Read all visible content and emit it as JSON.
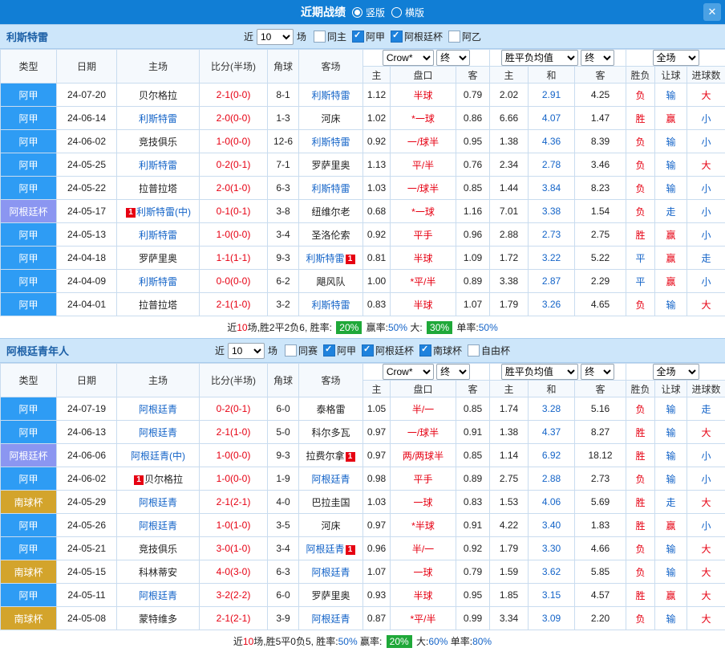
{
  "top_bar": {
    "title": "近期战绩",
    "vertical_label": "竖版",
    "horizontal_label": "横版",
    "close_label": "✕"
  },
  "table_header": {
    "type": "类型",
    "date": "日期",
    "home": "主场",
    "score": "比分(半场)",
    "corner": "角球",
    "away": "客场",
    "company_dd": "Crow*",
    "final_dd": "终",
    "europe_dd": "胜平负均值",
    "scope_dd": "全场",
    "sub": {
      "a_home": "主",
      "handicap": "盘口",
      "a_away": "客",
      "e_home": "主",
      "e_draw": "和",
      "e_away": "客",
      "result": "胜负",
      "let": "让球",
      "goals": "进球数"
    }
  },
  "colors": {
    "league_jia": "#2e9cf4",
    "league_cup": "#8b96f1",
    "league_south": "#d3a42c",
    "accent_red": "#e60012",
    "accent_blue": "#1464c8",
    "badge_green": "#1fa839",
    "topbar_blue": "#117ed5"
  },
  "sections": [
    {
      "team": "利斯特雷",
      "filter": {
        "near_label": "近",
        "count": "10",
        "games_label": "场",
        "checkboxes": [
          {
            "label": "同主",
            "checked": false
          },
          {
            "label": "阿甲",
            "checked": true
          },
          {
            "label": "阿根廷杯",
            "checked": true
          },
          {
            "label": "阿乙",
            "checked": false
          }
        ]
      },
      "rows": [
        {
          "league": "阿甲",
          "league_class": "jia",
          "date": "24-07-20",
          "home": {
            "name": "贝尔格拉"
          },
          "score": "2-1(0-0)",
          "corner": "8-1",
          "away": {
            "name": "利斯特雷",
            "focus": true
          },
          "asian": [
            "1.12",
            "半球",
            "0.79"
          ],
          "euro": [
            "2.02",
            "2.91",
            "4.25"
          ],
          "results": [
            {
              "t": "负",
              "c": "red"
            },
            {
              "t": "输",
              "c": "blue"
            },
            {
              "t": "大",
              "c": "red"
            }
          ]
        },
        {
          "league": "阿甲",
          "league_class": "jia",
          "date": "24-06-14",
          "home": {
            "name": "利斯特雷",
            "focus": true
          },
          "score": "2-0(0-0)",
          "corner": "1-3",
          "away": {
            "name": "河床"
          },
          "asian": [
            "1.02",
            "*一球",
            "0.86"
          ],
          "euro": [
            "6.66",
            "4.07",
            "1.47"
          ],
          "results": [
            {
              "t": "胜",
              "c": "red"
            },
            {
              "t": "赢",
              "c": "red"
            },
            {
              "t": "小",
              "c": "blue"
            }
          ]
        },
        {
          "league": "阿甲",
          "league_class": "jia",
          "date": "24-06-02",
          "home": {
            "name": "竞技俱乐"
          },
          "score": "1-0(0-0)",
          "corner": "12-6",
          "away": {
            "name": "利斯特雷",
            "focus": true
          },
          "asian": [
            "0.92",
            "一/球半",
            "0.95"
          ],
          "euro": [
            "1.38",
            "4.36",
            "8.39"
          ],
          "results": [
            {
              "t": "负",
              "c": "red"
            },
            {
              "t": "输",
              "c": "blue"
            },
            {
              "t": "小",
              "c": "blue"
            }
          ]
        },
        {
          "league": "阿甲",
          "league_class": "jia",
          "date": "24-05-25",
          "home": {
            "name": "利斯特雷",
            "focus": true
          },
          "score": "0-2(0-1)",
          "corner": "7-1",
          "away": {
            "name": "罗萨里奥"
          },
          "asian": [
            "1.13",
            "平/半",
            "0.76"
          ],
          "euro": [
            "2.34",
            "2.78",
            "3.46"
          ],
          "results": [
            {
              "t": "负",
              "c": "red"
            },
            {
              "t": "输",
              "c": "blue"
            },
            {
              "t": "大",
              "c": "red"
            }
          ]
        },
        {
          "league": "阿甲",
          "league_class": "jia",
          "date": "24-05-22",
          "home": {
            "name": "拉普拉塔"
          },
          "score": "2-0(1-0)",
          "corner": "6-3",
          "away": {
            "name": "利斯特雷",
            "focus": true
          },
          "asian": [
            "1.03",
            "一/球半",
            "0.85"
          ],
          "euro": [
            "1.44",
            "3.84",
            "8.23"
          ],
          "results": [
            {
              "t": "负",
              "c": "red"
            },
            {
              "t": "输",
              "c": "blue"
            },
            {
              "t": "小",
              "c": "blue"
            }
          ]
        },
        {
          "league": "阿根廷杯",
          "league_class": "cup",
          "date": "24-05-17",
          "home": {
            "name": "利斯特雷(中)",
            "focus": true,
            "badge_before": "1"
          },
          "score": "0-1(0-1)",
          "corner": "3-8",
          "away": {
            "name": "纽维尔老"
          },
          "asian": [
            "0.68",
            "*一球",
            "1.16"
          ],
          "euro": [
            "7.01",
            "3.38",
            "1.54"
          ],
          "results": [
            {
              "t": "负",
              "c": "red"
            },
            {
              "t": "走",
              "c": "blue"
            },
            {
              "t": "小",
              "c": "blue"
            }
          ]
        },
        {
          "league": "阿甲",
          "league_class": "jia",
          "date": "24-05-13",
          "home": {
            "name": "利斯特雷",
            "focus": true
          },
          "score": "1-0(0-0)",
          "corner": "3-4",
          "away": {
            "name": "圣洛伦索"
          },
          "asian": [
            "0.92",
            "平手",
            "0.96"
          ],
          "euro": [
            "2.88",
            "2.73",
            "2.75"
          ],
          "results": [
            {
              "t": "胜",
              "c": "red"
            },
            {
              "t": "赢",
              "c": "red"
            },
            {
              "t": "小",
              "c": "blue"
            }
          ]
        },
        {
          "league": "阿甲",
          "league_class": "jia",
          "date": "24-04-18",
          "home": {
            "name": "罗萨里奥"
          },
          "score": "1-1(1-1)",
          "corner": "9-3",
          "away": {
            "name": "利斯特雷",
            "focus": true,
            "badge_after": "1"
          },
          "asian": [
            "0.81",
            "半球",
            "1.09"
          ],
          "euro": [
            "1.72",
            "3.22",
            "5.22"
          ],
          "results": [
            {
              "t": "平",
              "c": "blue"
            },
            {
              "t": "赢",
              "c": "red"
            },
            {
              "t": "走",
              "c": "blue"
            }
          ]
        },
        {
          "league": "阿甲",
          "league_class": "jia",
          "date": "24-04-09",
          "home": {
            "name": "利斯特雷",
            "focus": true
          },
          "score": "0-0(0-0)",
          "corner": "6-2",
          "away": {
            "name": "飓风队"
          },
          "asian": [
            "1.00",
            "*平/半",
            "0.89"
          ],
          "euro": [
            "3.38",
            "2.87",
            "2.29"
          ],
          "results": [
            {
              "t": "平",
              "c": "blue"
            },
            {
              "t": "赢",
              "c": "red"
            },
            {
              "t": "小",
              "c": "blue"
            }
          ]
        },
        {
          "league": "阿甲",
          "league_class": "jia",
          "date": "24-04-01",
          "home": {
            "name": "拉普拉塔"
          },
          "score": "2-1(1-0)",
          "corner": "3-2",
          "away": {
            "name": "利斯特雷",
            "focus": true
          },
          "asian": [
            "0.83",
            "半球",
            "1.07"
          ],
          "euro": [
            "1.79",
            "3.26",
            "4.65"
          ],
          "results": [
            {
              "t": "负",
              "c": "red"
            },
            {
              "t": "输",
              "c": "blue"
            },
            {
              "t": "大",
              "c": "red"
            }
          ]
        }
      ],
      "summary": [
        {
          "t": "近",
          "c": "k"
        },
        {
          "t": "10",
          "c": "red"
        },
        {
          "t": "场,胜2平2负6, 胜率: ",
          "c": "k"
        },
        {
          "t": "20%",
          "c": "badge"
        },
        {
          "t": " 赢率:",
          "c": "k"
        },
        {
          "t": "50%",
          "c": "blue"
        },
        {
          "t": " 大: ",
          "c": "k"
        },
        {
          "t": "30%",
          "c": "badge"
        },
        {
          "t": " 单率:",
          "c": "k"
        },
        {
          "t": "50%",
          "c": "blue"
        }
      ]
    },
    {
      "team": "阿根廷青年人",
      "filter": {
        "near_label": "近",
        "count": "10",
        "games_label": "场",
        "checkboxes": [
          {
            "label": "同赛",
            "checked": false
          },
          {
            "label": "阿甲",
            "checked": true
          },
          {
            "label": "阿根廷杯",
            "checked": true
          },
          {
            "label": "南球杯",
            "checked": true
          },
          {
            "label": "自由杯",
            "checked": false
          }
        ]
      },
      "rows": [
        {
          "league": "阿甲",
          "league_class": "jia",
          "date": "24-07-19",
          "home": {
            "name": "阿根廷青",
            "focus": true
          },
          "score": "0-2(0-1)",
          "corner": "6-0",
          "away": {
            "name": "泰格雷"
          },
          "asian": [
            "1.05",
            "半/一",
            "0.85"
          ],
          "euro": [
            "1.74",
            "3.28",
            "5.16"
          ],
          "results": [
            {
              "t": "负",
              "c": "red"
            },
            {
              "t": "输",
              "c": "blue"
            },
            {
              "t": "走",
              "c": "blue"
            }
          ]
        },
        {
          "league": "阿甲",
          "league_class": "jia",
          "date": "24-06-13",
          "home": {
            "name": "阿根廷青",
            "focus": true
          },
          "score": "2-1(1-0)",
          "corner": "5-0",
          "away": {
            "name": "科尔多瓦"
          },
          "asian": [
            "0.97",
            "一/球半",
            "0.91"
          ],
          "euro": [
            "1.38",
            "4.37",
            "8.27"
          ],
          "results": [
            {
              "t": "胜",
              "c": "red"
            },
            {
              "t": "输",
              "c": "blue"
            },
            {
              "t": "大",
              "c": "red"
            }
          ]
        },
        {
          "league": "阿根廷杯",
          "league_class": "cup",
          "date": "24-06-06",
          "home": {
            "name": "阿根廷青(中)",
            "focus": true
          },
          "score": "1-0(0-0)",
          "corner": "9-3",
          "away": {
            "name": "拉费尔拿",
            "badge_after": "1"
          },
          "asian": [
            "0.97",
            "两/两球半",
            "0.85"
          ],
          "euro": [
            "1.14",
            "6.92",
            "18.12"
          ],
          "results": [
            {
              "t": "胜",
              "c": "red"
            },
            {
              "t": "输",
              "c": "blue"
            },
            {
              "t": "小",
              "c": "blue"
            }
          ]
        },
        {
          "league": "阿甲",
          "league_class": "jia",
          "date": "24-06-02",
          "home": {
            "name": "贝尔格拉",
            "badge_before": "1"
          },
          "score": "1-0(0-0)",
          "corner": "1-9",
          "away": {
            "name": "阿根廷青",
            "focus": true
          },
          "asian": [
            "0.98",
            "平手",
            "0.89"
          ],
          "euro": [
            "2.75",
            "2.88",
            "2.73"
          ],
          "results": [
            {
              "t": "负",
              "c": "red"
            },
            {
              "t": "输",
              "c": "blue"
            },
            {
              "t": "小",
              "c": "blue"
            }
          ]
        },
        {
          "league": "南球杯",
          "league_class": "south",
          "date": "24-05-29",
          "home": {
            "name": "阿根廷青",
            "focus": true
          },
          "score": "2-1(2-1)",
          "corner": "4-0",
          "away": {
            "name": "巴拉圭国"
          },
          "asian": [
            "1.03",
            "一球",
            "0.83"
          ],
          "euro": [
            "1.53",
            "4.06",
            "5.69"
          ],
          "results": [
            {
              "t": "胜",
              "c": "red"
            },
            {
              "t": "走",
              "c": "blue"
            },
            {
              "t": "大",
              "c": "red"
            }
          ]
        },
        {
          "league": "阿甲",
          "league_class": "jia",
          "date": "24-05-26",
          "home": {
            "name": "阿根廷青",
            "focus": true
          },
          "score": "1-0(1-0)",
          "corner": "3-5",
          "away": {
            "name": "河床"
          },
          "asian": [
            "0.97",
            "*半球",
            "0.91"
          ],
          "euro": [
            "4.22",
            "3.40",
            "1.83"
          ],
          "results": [
            {
              "t": "胜",
              "c": "red"
            },
            {
              "t": "赢",
              "c": "red"
            },
            {
              "t": "小",
              "c": "blue"
            }
          ]
        },
        {
          "league": "阿甲",
          "league_class": "jia",
          "date": "24-05-21",
          "home": {
            "name": "竞技俱乐"
          },
          "score": "3-0(1-0)",
          "corner": "3-4",
          "away": {
            "name": "阿根廷青",
            "focus": true,
            "badge_after": "1"
          },
          "asian": [
            "0.96",
            "半/一",
            "0.92"
          ],
          "euro": [
            "1.79",
            "3.30",
            "4.66"
          ],
          "results": [
            {
              "t": "负",
              "c": "red"
            },
            {
              "t": "输",
              "c": "blue"
            },
            {
              "t": "大",
              "c": "red"
            }
          ]
        },
        {
          "league": "南球杯",
          "league_class": "south",
          "date": "24-05-15",
          "home": {
            "name": "科林蒂安"
          },
          "score": "4-0(3-0)",
          "corner": "6-3",
          "away": {
            "name": "阿根廷青",
            "focus": true
          },
          "asian": [
            "1.07",
            "一球",
            "0.79"
          ],
          "euro": [
            "1.59",
            "3.62",
            "5.85"
          ],
          "results": [
            {
              "t": "负",
              "c": "red"
            },
            {
              "t": "输",
              "c": "blue"
            },
            {
              "t": "大",
              "c": "red"
            }
          ]
        },
        {
          "league": "阿甲",
          "league_class": "jia",
          "date": "24-05-11",
          "home": {
            "name": "阿根廷青",
            "focus": true
          },
          "score": "3-2(2-2)",
          "corner": "6-0",
          "away": {
            "name": "罗萨里奥"
          },
          "asian": [
            "0.93",
            "半球",
            "0.95"
          ],
          "euro": [
            "1.85",
            "3.15",
            "4.57"
          ],
          "results": [
            {
              "t": "胜",
              "c": "red"
            },
            {
              "t": "赢",
              "c": "red"
            },
            {
              "t": "大",
              "c": "red"
            }
          ]
        },
        {
          "league": "南球杯",
          "league_class": "south",
          "date": "24-05-08",
          "home": {
            "name": "蒙特维多"
          },
          "score": "2-1(2-1)",
          "corner": "3-9",
          "away": {
            "name": "阿根廷青",
            "focus": true
          },
          "asian": [
            "0.87",
            "*平/半",
            "0.99"
          ],
          "euro": [
            "3.34",
            "3.09",
            "2.20"
          ],
          "results": [
            {
              "t": "负",
              "c": "red"
            },
            {
              "t": "输",
              "c": "blue"
            },
            {
              "t": "大",
              "c": "red"
            }
          ]
        }
      ],
      "summary": [
        {
          "t": "近",
          "c": "k"
        },
        {
          "t": "10",
          "c": "red"
        },
        {
          "t": "场,胜5平0负5, 胜率:",
          "c": "k"
        },
        {
          "t": "50%",
          "c": "blue"
        },
        {
          "t": " 赢率: ",
          "c": "k"
        },
        {
          "t": "20%",
          "c": "badge"
        },
        {
          "t": " 大:",
          "c": "k"
        },
        {
          "t": "60%",
          "c": "blue"
        },
        {
          "t": " 单率:",
          "c": "k"
        },
        {
          "t": "80%",
          "c": "blue"
        }
      ]
    }
  ]
}
